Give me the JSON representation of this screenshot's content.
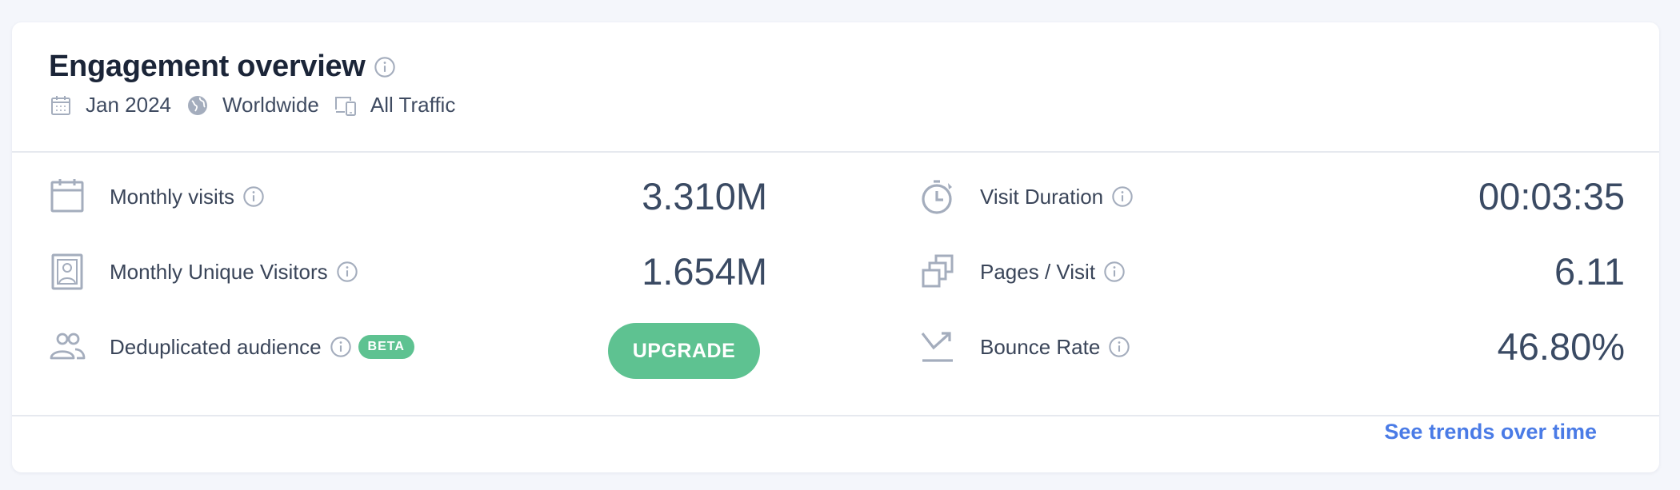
{
  "header": {
    "title": "Engagement overview",
    "filters": {
      "date": "Jan 2024",
      "region": "Worldwide",
      "traffic": "All Traffic"
    }
  },
  "metrics_left": [
    {
      "label": "Monthly visits",
      "value": "3.310M",
      "icon": "calendar-icon"
    },
    {
      "label": "Monthly Unique Visitors",
      "value": "1.654M",
      "icon": "person-card-icon"
    },
    {
      "label": "Deduplicated audience",
      "badge": "BETA",
      "action": "UPGRADE",
      "icon": "people-icon"
    }
  ],
  "metrics_right": [
    {
      "label": "Visit Duration",
      "value": "00:03:35",
      "icon": "stopwatch-icon"
    },
    {
      "label": "Pages / Visit",
      "value": "6.11",
      "icon": "pages-icon"
    },
    {
      "label": "Bounce Rate",
      "value": "46.80%",
      "icon": "bounce-arrow-icon"
    }
  ],
  "footer": {
    "link": "See trends over time"
  },
  "colors": {
    "accent_green": "#5ec291",
    "link_blue": "#4a7be6",
    "icon_gray": "#a4adbd",
    "text_dark": "#1b2538"
  }
}
